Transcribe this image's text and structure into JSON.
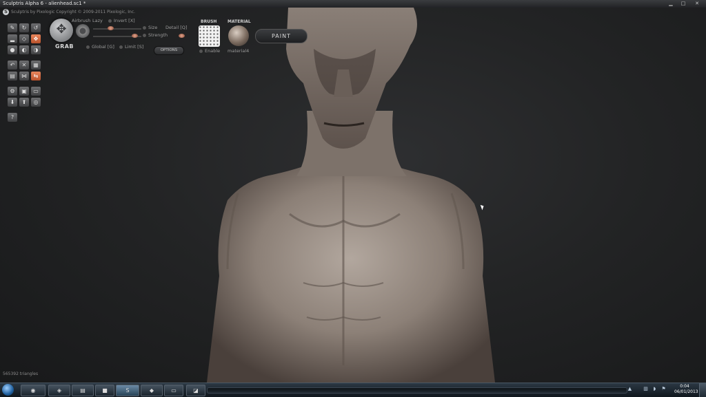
{
  "window": {
    "title": "Sculptris Alpha 6 - alienhead.sc1 *",
    "min_glyph": "▁",
    "max_glyph": "□",
    "close_glyph": "✕"
  },
  "header": {
    "app_line": "Sculptris by Pixologic    Copyright © 2009-2011 Pixologic, Inc."
  },
  "tool": {
    "grab_label": "GRAB",
    "airbrush": "Airbrush",
    "lazy": "Lazy",
    "invert": "Invert [X]",
    "size": "Size",
    "detail": "Detail [Q]",
    "strength": "Strength",
    "global": "Global [G]",
    "limit": "Limit [S]",
    "options": "OPTIONS"
  },
  "brush": {
    "label": "BRUSH",
    "enable": "Enable"
  },
  "material": {
    "label": "MATERIAL",
    "name": "material4"
  },
  "paint_button": "PAINT",
  "status": {
    "triangles": "565392 triangles"
  },
  "clock": {
    "time": "0:04",
    "date": "06/01/2013"
  },
  "colors": {
    "accent": "#d9693c",
    "model": "#a89d94"
  }
}
